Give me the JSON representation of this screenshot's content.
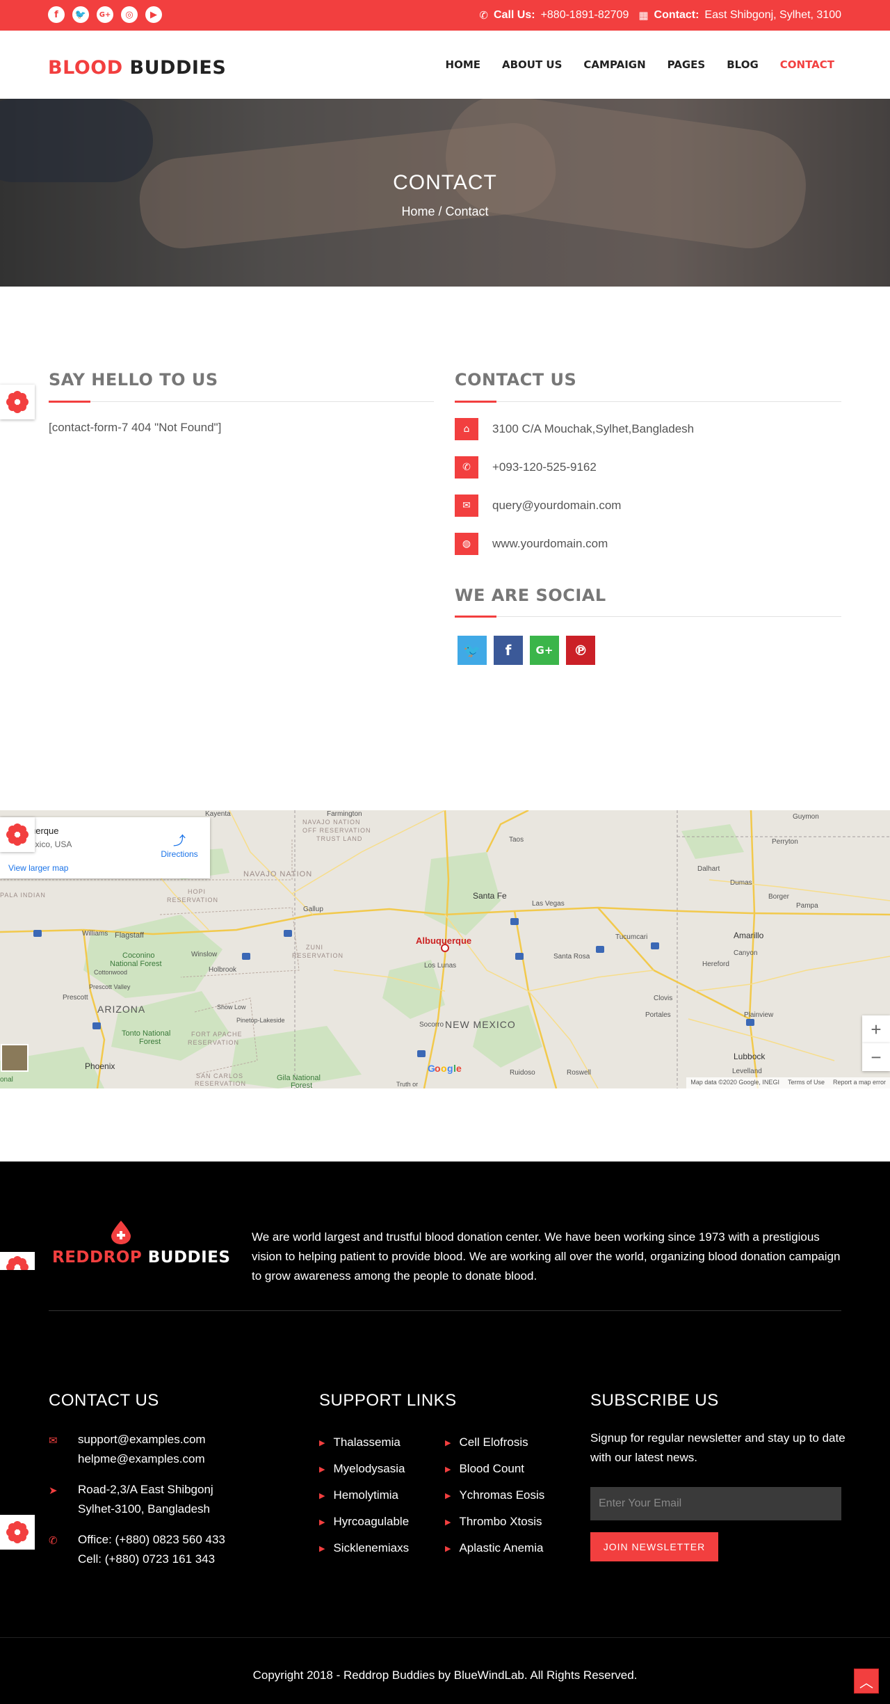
{
  "topbar": {
    "call_label": "Call Us:",
    "phone": "+880-1891-82709",
    "contact_label": "Contact:",
    "address": "East Shibgonj, Sylhet, 3100",
    "social_icons": [
      "facebook-icon",
      "twitter-icon",
      "google-plus-icon",
      "instagram-icon",
      "youtube-icon"
    ]
  },
  "header": {
    "logo_red": "BLOOD",
    "logo_dark": "BUDDIES",
    "nav": [
      "HOME",
      "ABOUT US",
      "CAMPAIGN",
      "PAGES",
      "BLOG",
      "CONTACT"
    ]
  },
  "hero": {
    "title": "CONTACT",
    "crumb_home": "Home",
    "crumb_sep": "/",
    "crumb_current": "Contact"
  },
  "say_hello": {
    "title": "SAY HELLO TO US",
    "form_text": "[contact-form-7 404 \"Not Found\"]"
  },
  "contact_us": {
    "title": "CONTACT US",
    "items": [
      {
        "icon": "home-icon",
        "text": "3100 C/A Mouchak,Sylhet,Bangladesh"
      },
      {
        "icon": "phone-icon",
        "text": "+093-120-525-9162"
      },
      {
        "icon": "envelope-icon",
        "text": "query@yourdomain.com"
      },
      {
        "icon": "globe-icon",
        "text": "www.yourdomain.com"
      }
    ]
  },
  "social": {
    "title": "WE ARE SOCIAL",
    "buttons": [
      {
        "icon": "twitter-icon",
        "color": "#40a9e6"
      },
      {
        "icon": "facebook-icon",
        "color": "#3b5998"
      },
      {
        "icon": "google-plus-icon",
        "color": "#3bb54a"
      },
      {
        "icon": "pinterest-icon",
        "color": "#cb2027"
      }
    ]
  },
  "map": {
    "place_name": "uerque",
    "place_region": "exico, USA",
    "directions": "Directions",
    "larger_map": "View larger map",
    "labels": [
      "Farmington",
      "Kayenta",
      "NAVAJO NATION",
      "NAVAJO NATION OFF RESERVATION TRUST LAND",
      "Taos",
      "Guymon",
      "Perryton",
      "HOPI RESERVATION",
      "Gallup",
      "Santa Fe",
      "Las Vegas",
      "Dalhart",
      "Dumas",
      "Borger",
      "Pampa",
      "Flagstaff",
      "Williams",
      "Winslow",
      "ZUNI RESERVATION",
      "Albuquerque",
      "Los Lunas",
      "Santa Rosa",
      "Tucumcari",
      "Amarillo",
      "Canyon",
      "Hereford",
      "Coconino National Forest",
      "Holbrook",
      "Clovis",
      "Portales",
      "Plainview",
      "Prescott",
      "ARIZONA",
      "Show Low",
      "Pinetop-Lakeside",
      "Socorro",
      "NEW MEXICO",
      "Tonto National Forest",
      "FORT APACHE RESERVATION",
      "Phoenix",
      "SAN CARLOS RESERVATION",
      "Gila National Forest",
      "Ruidoso",
      "Roswell",
      "Lubbock",
      "Levelland",
      "Prescott Valley",
      "Cottonwood",
      "PALA INDIAN",
      "Truth or"
    ],
    "attribution": [
      "Map data ©2020 Google, INEGI",
      "Terms of Use",
      "Report a map error"
    ],
    "google": "Google"
  },
  "footer": {
    "logo_red": "REDDROP",
    "logo_white": "BUDDIES",
    "about": "We are world largest and trustful blood donation center. We have been working since 1973 with a prestigious vision to helping patient to provide blood. We are working all over the world, organizing blood donation campaign to grow awareness among the people to donate blood.",
    "contact_title": "CONTACT US",
    "contact": {
      "email1": "support@examples.com",
      "email2": "helpme@examples.com",
      "addr1": "Road-2,3/A East Shibgonj",
      "addr2": "Sylhet-3100, Bangladesh",
      "office": "Office: (+880) 0823 560 433",
      "cell": "Cell: (+880) 0723 161 343"
    },
    "support_title": "SUPPORT LINKS",
    "links_col1": [
      "Thalassemia",
      "Myelodysasia",
      "Hemolytimia",
      "Hyrcoagulable",
      "Sicklenemiaxs"
    ],
    "links_col2": [
      "Cell Elofrosis",
      "Blood Count",
      "Ychromas Eosis",
      "Thrombo Xtosis",
      "Aplastic Anemia"
    ],
    "subscribe_title": "SUBSCRIBE US",
    "subscribe_text": "Signup for regular newsletter and stay up to date with our latest news.",
    "email_placeholder": "Enter Your Email",
    "join_label": "JOIN NEWSLETTER",
    "copyright": "Copyright 2018 - Reddrop Buddies by BlueWindLab. All Rights Reserved."
  }
}
